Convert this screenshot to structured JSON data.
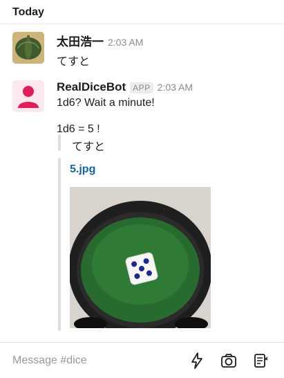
{
  "channel": {
    "day_label": "Today"
  },
  "messages": [
    {
      "username": "太田浩一",
      "time": "2:03 AM",
      "text": "てすと",
      "avatar_icon": "pumpkin-avatar"
    },
    {
      "username": "RealDiceBot",
      "badge": "APP",
      "time": "2:03 AM",
      "text": "1d6? Wait a minute!",
      "result": "1d6 = 5 !",
      "quote": "てすと",
      "attachment": {
        "filename": "5.jpg",
        "image_icon": "dice-photo"
      },
      "avatar_icon": "person-icon"
    }
  ],
  "composer": {
    "placeholder": "Message #dice",
    "icons": [
      "lightning-icon",
      "camera-icon",
      "clipboard-icon"
    ]
  },
  "colors": {
    "link": "#1264a3",
    "bot_avatar": "#e01e5a"
  }
}
